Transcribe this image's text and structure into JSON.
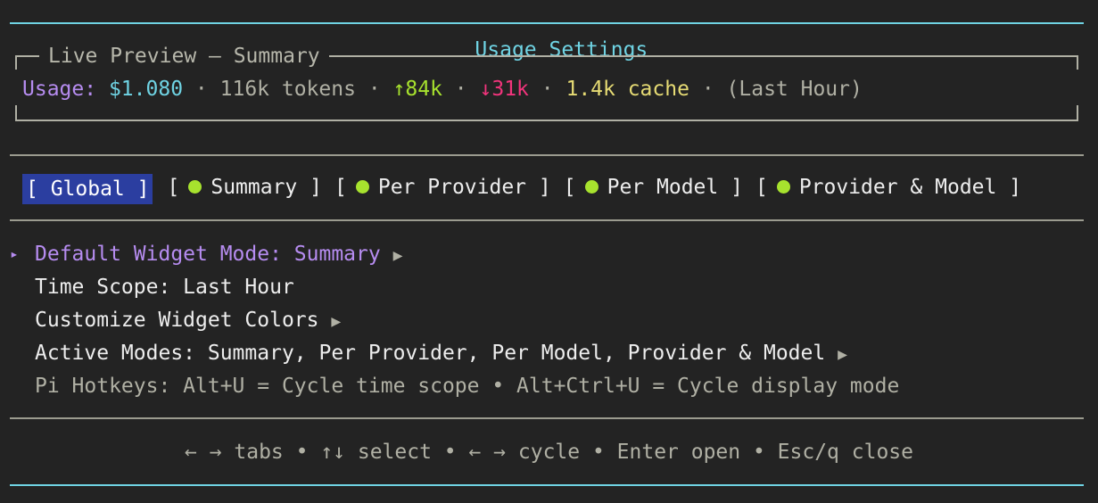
{
  "title": "Usage Settings",
  "preview": {
    "label": "Live Preview – Summary",
    "usage_label": "Usage:",
    "cost": "$1.080",
    "sep": "·",
    "tokens": "116k tokens",
    "up": "↑84k",
    "down": "↓31k",
    "cache": "1.4k cache",
    "scope": "(Last Hour)"
  },
  "tabs": [
    {
      "label": "[ Global ]",
      "active": true,
      "dot": false
    },
    {
      "label_open": "[",
      "label": "Summary",
      "label_close": "]",
      "dot": true
    },
    {
      "label_open": "[",
      "label": "Per Provider",
      "label_close": "]",
      "dot": true
    },
    {
      "label_open": "[",
      "label": "Per Model",
      "label_close": "]",
      "dot": true
    },
    {
      "label_open": "[",
      "label": "Provider & Model",
      "label_close": "]",
      "dot": true
    }
  ],
  "settings": {
    "cursor": "▸",
    "items": [
      {
        "label": "Default Widget Mode: Summary",
        "arrow": "▶"
      },
      {
        "label": "Time Scope: Last Hour"
      },
      {
        "label": "Customize Widget Colors",
        "arrow": "▶"
      },
      {
        "label": "Active Modes: Summary, Per Provider, Per Model, Provider & Model",
        "arrow": "▶"
      },
      {
        "label": "Pi Hotkeys: Alt+U = Cycle time scope • Alt+Ctrl+U = Cycle display mode"
      }
    ]
  },
  "footer": "← → tabs • ↑↓ select • ← → cycle • Enter open • Esc/q close",
  "colors": {
    "accent_cyan": "#6fd3e3",
    "accent_purple": "#b68cf0",
    "up_green": "#a7e22e",
    "down_pink": "#f2347c",
    "cache_yellow": "#e6db74",
    "active_tab_bg": "#2b3ea0"
  }
}
